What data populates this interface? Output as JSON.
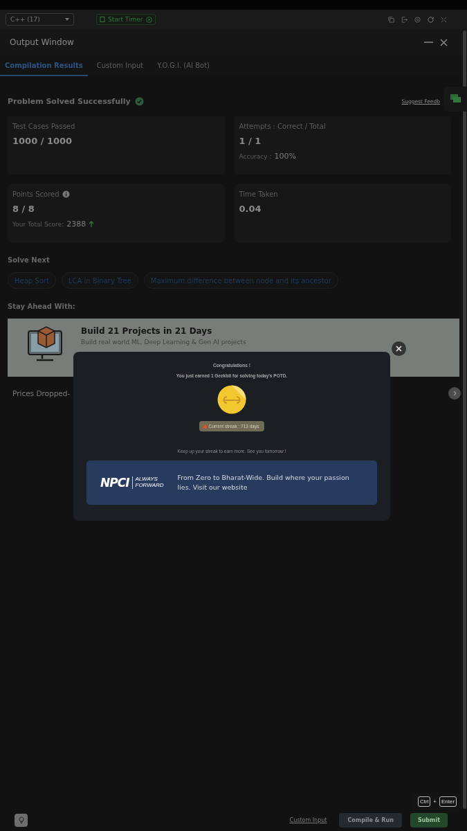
{
  "toolbar": {
    "language": "C++ (17)",
    "timer_button": "Start Timer"
  },
  "output_window": {
    "title": "Output Window"
  },
  "tabs": [
    {
      "label": "Compilation Results",
      "selected": true
    },
    {
      "label": "Custom Input",
      "selected": false
    },
    {
      "label": "Y.O.G.I. (AI Bot)",
      "selected": false
    }
  ],
  "result": {
    "status": "Problem Solved Successfully",
    "feedback_link": "Suggest Feedb"
  },
  "stats": [
    {
      "label": "Test Cases Passed",
      "value": "1000 / 1000"
    },
    {
      "label": "Attempts : Correct / Total",
      "value": "1 / 1",
      "sub_label": "Accuracy :",
      "sub_value": "100%"
    },
    {
      "label": "Points Scored",
      "value": "8 / 8",
      "sub_label": "Your Total Score:",
      "sub_value": "2388",
      "info": true,
      "trend_up": true
    },
    {
      "label": "Time Taken",
      "value": "0.04"
    }
  ],
  "solve_next": {
    "heading": "Solve Next",
    "items": [
      "Heap Sort",
      "LCA in Binary Tree",
      "Maximum difference between node and its ancestor"
    ]
  },
  "stay_ahead": {
    "heading": "Stay Ahead With:",
    "banner_title": "Build 21 Projects in 21 Days",
    "banner_text": "Build real world ML, Deep Learning & Gen AI projects",
    "promo_text": "Prices Dropped-"
  },
  "modal": {
    "title": "Congratulations !",
    "message": "You just earned 1 Geekbit for solving today's POTD.",
    "streak": "Current streak : 713 days",
    "footer": "Keep up your streak to earn more. See you tomorrow !",
    "ad": {
      "logo_main": "NPCI",
      "logo_tag_1": "ALWAYS",
      "logo_tag_2": "FORWARD",
      "text": "From Zero to Bharat-Wide. Build where your passion lies. Visit our website"
    }
  },
  "shortcut": {
    "keys": [
      "Ctrl",
      "Enter"
    ],
    "joiner": "+"
  },
  "bottom_bar": {
    "custom_input_link": "Custom Input",
    "compile_button": "Compile & Run",
    "submit_button": "Submit"
  }
}
